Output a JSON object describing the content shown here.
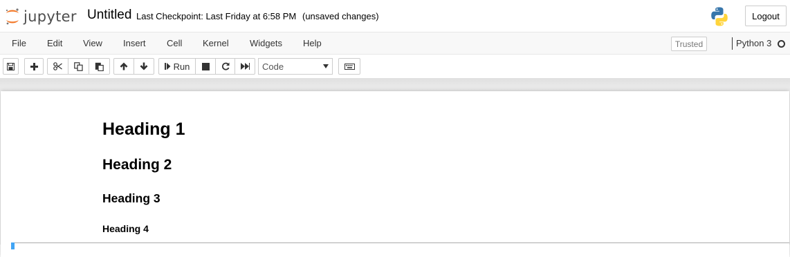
{
  "header": {
    "logo_text": "jupyter",
    "notebook_title": "Untitled",
    "checkpoint": "Last Checkpoint: Last Friday at 6:58 PM",
    "save_status": "(unsaved changes)",
    "logout_label": "Logout"
  },
  "menubar": {
    "items": [
      "File",
      "Edit",
      "View",
      "Insert",
      "Cell",
      "Kernel",
      "Widgets",
      "Help"
    ],
    "trusted_label": "Trusted",
    "kernel_name": "Python 3"
  },
  "toolbar": {
    "run_label": "Run",
    "cell_type": "Code",
    "icons": [
      "save-icon",
      "plus-icon",
      "cut-icon",
      "copy-icon",
      "paste-icon",
      "arrow-up-icon",
      "arrow-down-icon",
      "step-forward-icon",
      "stop-icon",
      "restart-icon",
      "fast-forward-icon",
      "keyboard-icon"
    ]
  },
  "cells": {
    "headings": [
      "Heading 1",
      "Heading 2",
      "Heading 3",
      "Heading 4"
    ]
  },
  "colors": {
    "jupyter_orange": "#f37726",
    "selected_cell_marker": "#42a5f5"
  }
}
